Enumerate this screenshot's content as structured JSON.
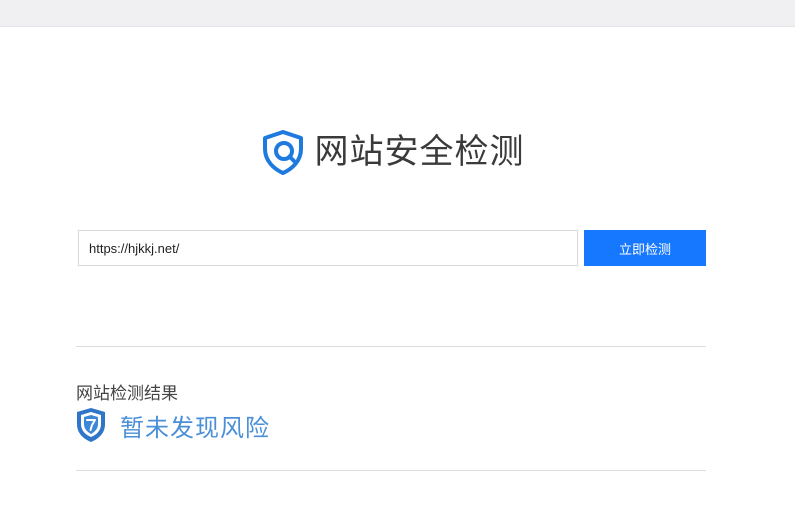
{
  "header": {
    "title": "网站安全检测",
    "logo_icon": "shield-search-icon"
  },
  "search": {
    "value": "https://hjkkj.net/"
  },
  "actions": {
    "check_label": "立即检测"
  },
  "result": {
    "label": "网站检测结果",
    "status": "暂未发现风险",
    "status_icon": "shield-check-icon"
  },
  "colors": {
    "accent": "#1677ff",
    "status": "#4a8fd8",
    "topbar": "#f0f0f3"
  }
}
